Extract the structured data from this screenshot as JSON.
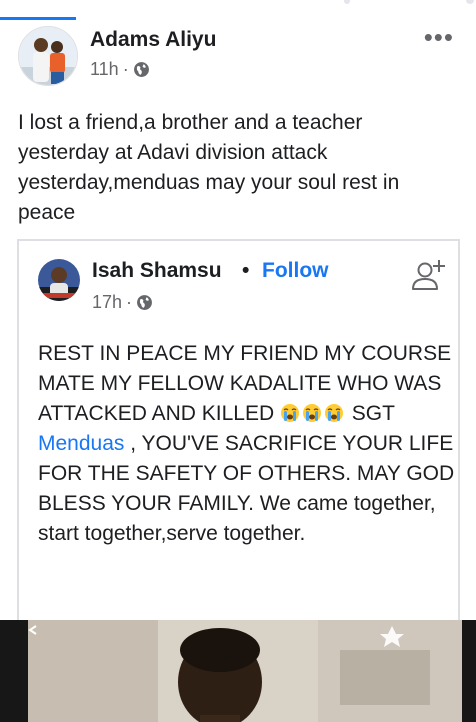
{
  "post": {
    "author": "Adams Aliyu",
    "time": "11h",
    "separator": "·",
    "privacy_icon": "globe-icon",
    "more_icon": "more-options-icon",
    "text": "I lost a friend,a brother and a teacher yesterday at Adavi division attack yesterday,menduas may your soul rest in peace"
  },
  "shared_post": {
    "author": "Isah Shamsu",
    "dot": "•",
    "follow_label": "Follow",
    "time": "17h",
    "separator": "·",
    "privacy_icon": "globe-icon",
    "add_friend_icon": "add-friend-icon",
    "text_part1": "REST IN PEACE MY FRIEND MY COURSE MATE MY FELLOW KADALITE WHO WAS ATTACKED AND KILLED ",
    "emojis": [
      "crying-face",
      "crying-face",
      "crying-face"
    ],
    "text_part2": " SGT ",
    "mention": "Menduas",
    "text_part3": " , YOU'VE SACRIFICE YOUR LIFE FOR THE SAFETY OF OTHERS. MAY GOD BLESS YOUR FAMILY. We came together, start together,serve together."
  },
  "colors": {
    "link": "#1877f2",
    "secondary_text": "#65676b",
    "text": "#1c1e21",
    "border": "#dddfe2"
  }
}
